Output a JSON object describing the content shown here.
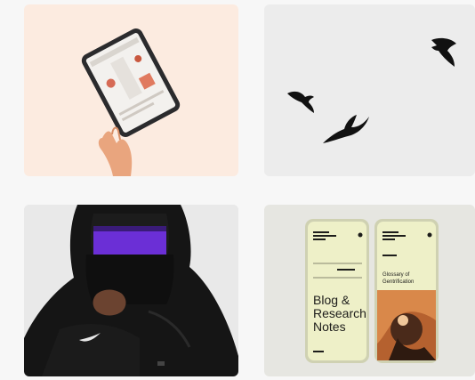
{
  "gallery": {
    "tiles": [
      {
        "subject": "tablet-held-by-hand"
      },
      {
        "subject": "swifts-flying"
      },
      {
        "subject": "hooded-figure"
      },
      {
        "subject": "phone-mockups",
        "phone_left": {
          "headline": "Blog & Research Notes"
        },
        "phone_right": {
          "headline": "Glossary of Gentrification"
        }
      }
    ]
  },
  "colors": {
    "tile_peach": "#fcebe0",
    "tile_gray": "#ececec",
    "phone_cream": "#eef0c8",
    "purple_stripe": "#6b2fd6"
  }
}
